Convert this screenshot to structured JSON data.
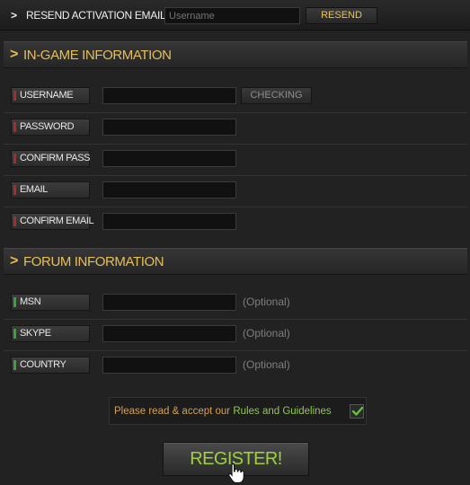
{
  "resend": {
    "label": "RESEND ACTIVATION EMAIL :",
    "input_placeholder": "Username",
    "button_label": "RESEND"
  },
  "sections": {
    "ingame_title": "IN-GAME INFORMATION",
    "forum_title": "FORUM INFORMATION"
  },
  "ingame_fields": {
    "username": "USERNAME",
    "password": "PASSWORD",
    "confirm_pass": "CONFIRM PASS",
    "email": "EMAIL",
    "confirm_email": "CONFIRM EMAIL",
    "checking_label": "CHECKING"
  },
  "forum_fields": {
    "msn": "MSN",
    "skype": "SKYPE",
    "country": "COUNTRY",
    "optional_hint": "(Optional)"
  },
  "rules": {
    "prefix": "Please read & accept our ",
    "link": "Rules and Guidelines",
    "checked": true
  },
  "register": {
    "label": "REGISTER!"
  },
  "icons": {
    "chevron": "chevron-right-icon",
    "check": "checkmark-icon",
    "cursor": "hand-pointer-icon"
  },
  "colors": {
    "accent_gold": "#e6bf5a",
    "accent_green": "#9fd13c",
    "required_marker": "#a82c2c",
    "optional_marker": "#3aa23a"
  }
}
